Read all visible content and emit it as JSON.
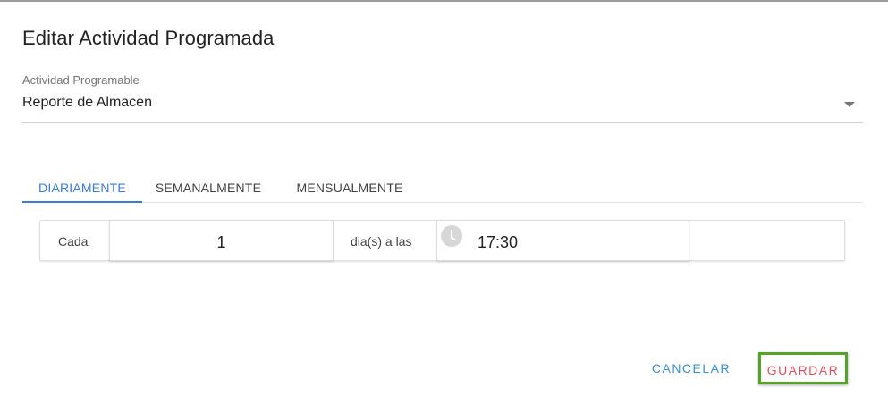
{
  "dialog": {
    "title": "Editar Actividad Programada"
  },
  "activity_field": {
    "label": "Actividad Programable",
    "value": "Reporte de Almacen"
  },
  "tabs": [
    {
      "label": "DIARIAMENTE",
      "active": true
    },
    {
      "label": "SEMANALMENTE",
      "active": false
    },
    {
      "label": "MENSUALMENTE",
      "active": false
    }
  ],
  "schedule": {
    "every_label": "Cada",
    "every_value": "1",
    "unit_label": "dia(s) a las",
    "time_value": "17:30"
  },
  "actions": {
    "cancel_label": "CANCELAR",
    "save_label": "GUARDAR"
  },
  "colors": {
    "accent_tab": "#3d7bd6",
    "cancel": "#3a8fd0",
    "save_text": "#e0505b",
    "save_highlight_border": "#57a22b"
  }
}
